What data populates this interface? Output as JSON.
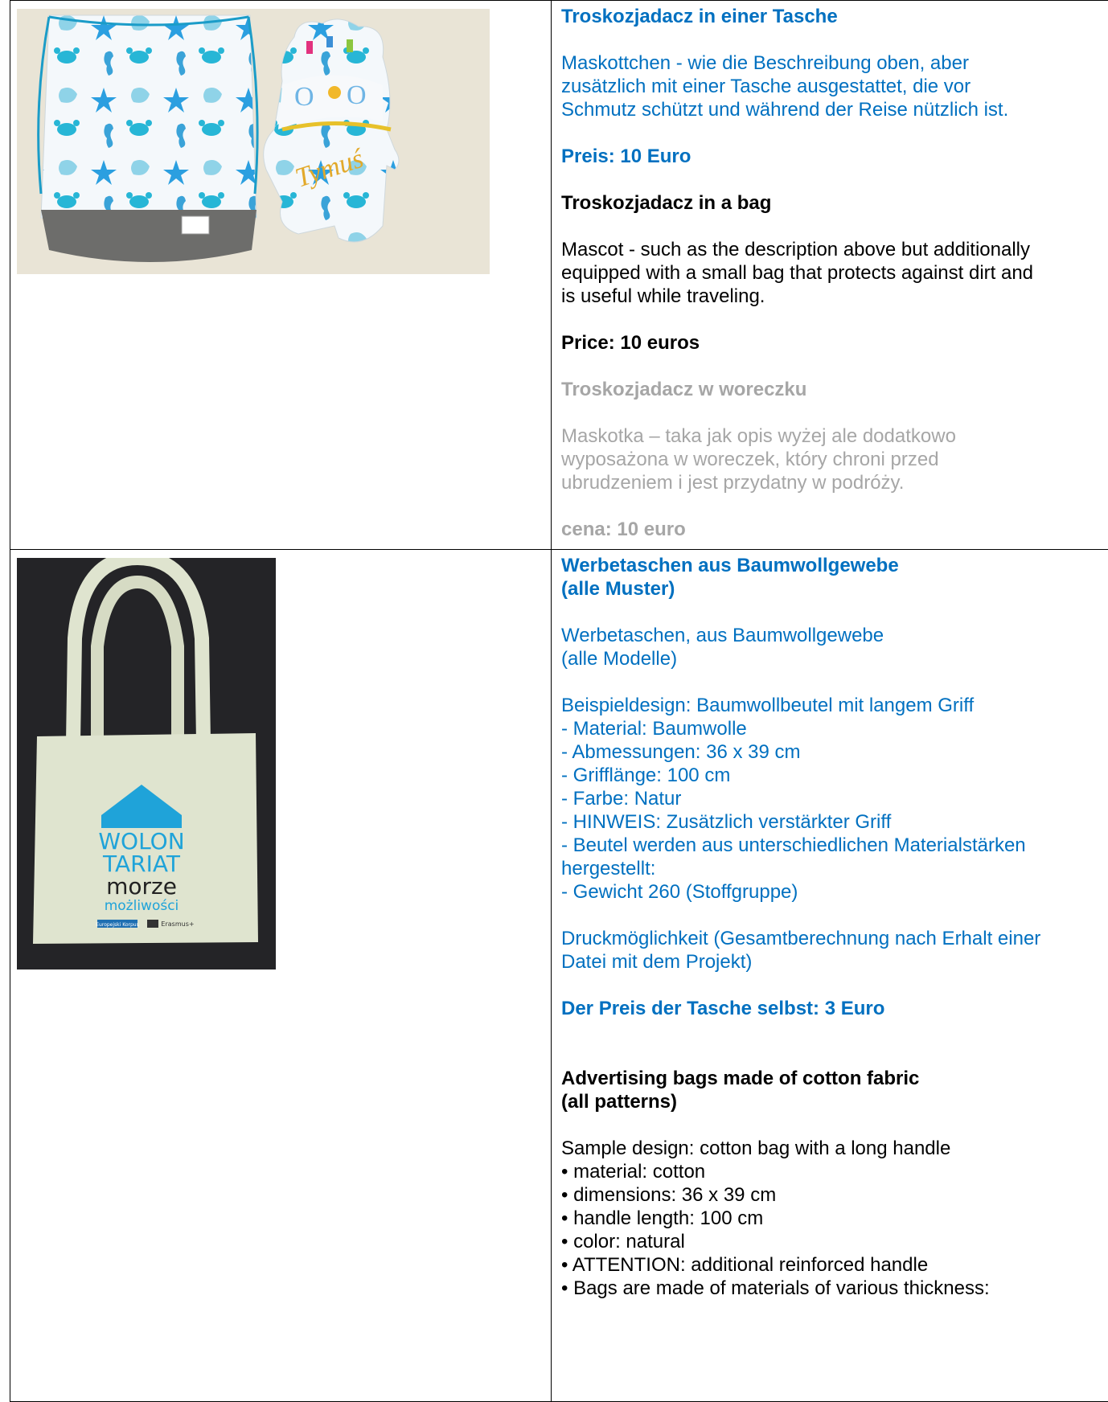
{
  "row1": {
    "de_title": "Troskozjadacz in einer Tasche",
    "de_desc": "Maskottchen - wie die Beschreibung oben, aber\nzusätzlich mit einer Tasche ausgestattet, die vor\nSchmutz schützt und während der Reise nützlich ist.",
    "de_price": "Preis: 10 Euro",
    "en_title": "Troskozjadacz in a bag",
    "en_desc": "Mascot - such as the description above but additionally\nequipped with a small bag that protects against dirt and\nis useful while traveling.",
    "en_price": "Price: 10 euros",
    "pl_title": "Troskozjadacz w woreczku",
    "pl_desc": "Maskotka – taka jak opis wyżej ale dodatkowo\nwyposażona w woreczek, który chroni przed\nubrudzeniem i jest przydatny w podróży.",
    "pl_price": "cena: 10 euro",
    "photo_embroidery": "Tymuś"
  },
  "row2": {
    "de_title": "Werbetaschen aus Baumwollgewebe\n(alle Muster)",
    "de_intro": "Werbetaschen, aus Baumwollgewebe\n(alle Modelle)",
    "de_spec": "Beispieldesign: Baumwollbeutel mit langem Griff\n- Material: Baumwolle\n- Abmessungen: 36 x 39 cm\n- Grifflänge: 100 cm\n- Farbe: Natur\n- HINWEIS: Zusätzlich verstärkter Griff\n- Beutel werden aus unterschiedlichen Materialstärken\nhergestellt:\n- Gewicht 260 (Stoffgruppe)",
    "de_print": "Druckmöglichkeit (Gesamtberechnung nach Erhalt einer\nDatei mit dem Projekt)",
    "de_price": "Der Preis der Tasche selbst: 3 Euro",
    "en_title": "Advertising bags made of cotton fabric\n(all patterns)",
    "en_spec": "Sample design: cotton bag with a long handle\n• material: cotton\n• dimensions: 36 x 39 cm\n• handle length: 100 cm\n• color: natural\n• ATTENTION: additional reinforced handle\n• Bags are made of materials of various thickness:",
    "bag_print": {
      "line1": "WOLON",
      "line2": "TARIAT",
      "line3": "morze",
      "line4": "możliwości",
      "logo1": "Europejski Korpus",
      "logo2": "Erasmus+"
    }
  }
}
